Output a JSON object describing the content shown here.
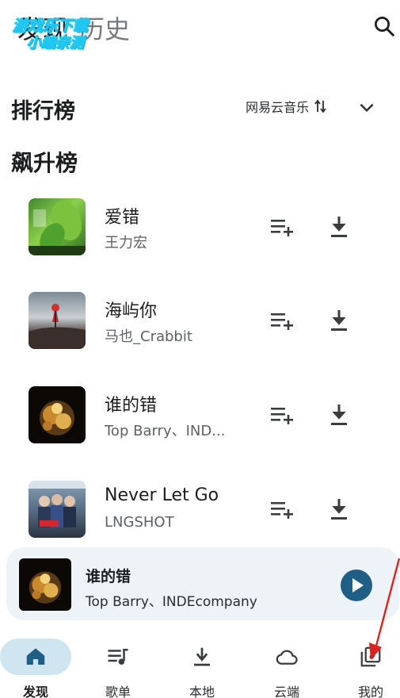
{
  "top_bar": {
    "tabs": [
      "发现",
      "历史"
    ],
    "watermark_line1": "游戏乐下载",
    "watermark_line2": "小编亲测"
  },
  "section": {
    "title": "排行榜",
    "source": "网易云音乐"
  },
  "chart": {
    "title": "飙升榜",
    "songs": [
      {
        "title": "爱错",
        "artist": "王力宏"
      },
      {
        "title": "海屿你",
        "artist": "马也_Crabbit"
      },
      {
        "title": "谁的错",
        "artist": "Top Barry、IND..."
      },
      {
        "title": "Never Let Go",
        "artist": "LNGSHOT"
      }
    ]
  },
  "mini_player": {
    "title": "谁的错",
    "artist": "Top Barry、INDEcompany"
  },
  "nav": {
    "items": [
      "发现",
      "歌单",
      "本地",
      "云端",
      "我的"
    ]
  },
  "colors": {
    "accent": "#1f5f86",
    "nav_active_bg": "#cfe6f1",
    "annotation": "#e0201c"
  }
}
